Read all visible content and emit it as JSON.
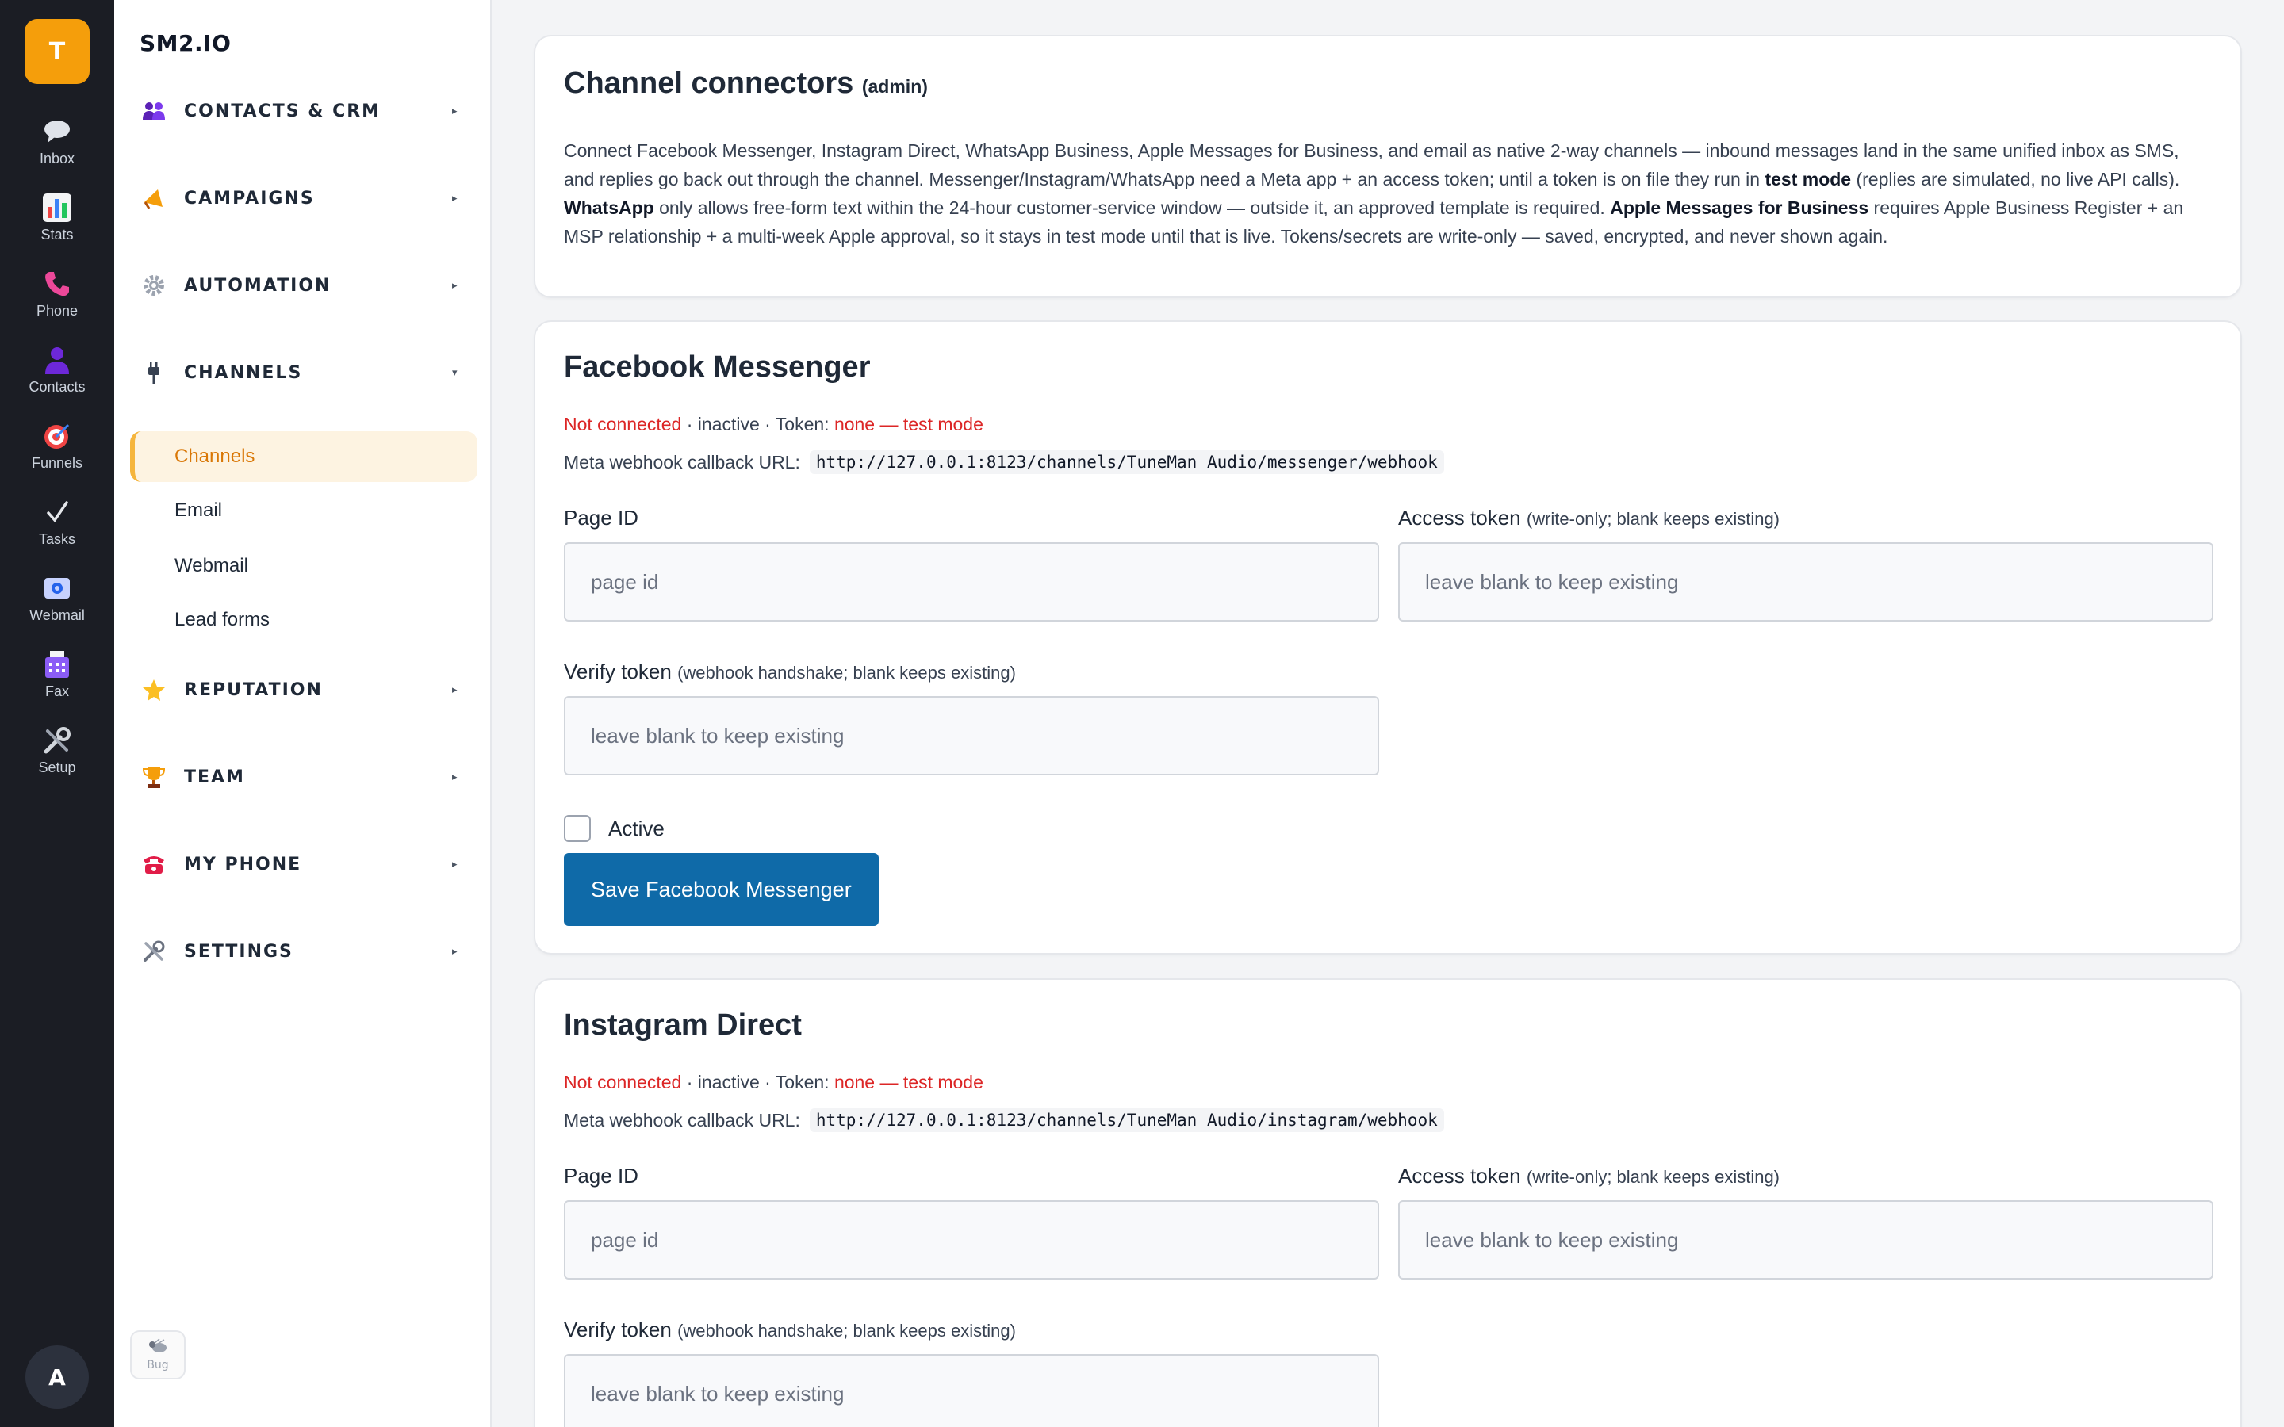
{
  "rail": {
    "brand_letter": "T",
    "items": [
      {
        "label": "Inbox",
        "icon": "speech-bubble-icon"
      },
      {
        "label": "Stats",
        "icon": "bar-chart-icon"
      },
      {
        "label": "Phone",
        "icon": "phone-icon"
      },
      {
        "label": "Contacts",
        "icon": "person-icon"
      },
      {
        "label": "Funnels",
        "icon": "target-icon"
      },
      {
        "label": "Tasks",
        "icon": "checkmark-icon"
      },
      {
        "label": "Webmail",
        "icon": "envelope-icon"
      },
      {
        "label": "Fax",
        "icon": "fax-icon"
      },
      {
        "label": "Setup",
        "icon": "tools-icon"
      }
    ],
    "avatar_letter": "A"
  },
  "sidebar": {
    "brand": "SM2.IO",
    "groups": [
      {
        "label": "CONTACTS & CRM",
        "caret": "▸",
        "icon": "people-icon"
      },
      {
        "label": "CAMPAIGNS",
        "caret": "▸",
        "icon": "megaphone-icon"
      },
      {
        "label": "AUTOMATION",
        "caret": "▸",
        "icon": "gear-icon"
      },
      {
        "label": "CHANNELS",
        "caret": "▾",
        "icon": "plug-icon"
      },
      {
        "label": "REPUTATION",
        "caret": "▸",
        "icon": "star-icon"
      },
      {
        "label": "TEAM",
        "caret": "▸",
        "icon": "trophy-icon"
      },
      {
        "label": "MY PHONE",
        "caret": "▸",
        "icon": "telephone-icon"
      },
      {
        "label": "SETTINGS",
        "caret": "▸",
        "icon": "tools-icon"
      }
    ],
    "channel_items": [
      "Channels",
      "Email",
      "Webmail",
      "Lead forms"
    ],
    "bug_label": "Bug"
  },
  "intro_card": {
    "title": "Channel connectors",
    "title_suffix": "(admin)",
    "p1": "Connect Facebook Messenger, Instagram Direct, WhatsApp Business, Apple Messages for Business, and email as native 2-way channels — inbound messages land in the same unified inbox as SMS, and replies go back out through the channel. Messenger/Instagram/WhatsApp need a Meta app + an access token; until a token is on file they run in ",
    "b1": "test mode",
    "p2": " (replies are simulated, no live API calls). ",
    "b2": "WhatsApp",
    "p3": " only allows free-form text within the 24-hour customer-service window — outside it, an approved template is required. ",
    "b3": "Apple Messages for Business",
    "p4": " requires Apple Business Register + an MSP relationship + a multi-week Apple approval, so it stays in test mode until that is live. Tokens/secrets are write-only — saved, encrypted, and never shown again."
  },
  "messenger": {
    "title": "Facebook Messenger",
    "status_conn": "Not connected",
    "status_mid": " · inactive · Token: ",
    "status_token": "none — test mode",
    "webhook_label": "Meta webhook callback URL:",
    "webhook_url": "http://127.0.0.1:8123/channels/TuneMan Audio/messenger/webhook",
    "page_id_label": "Page ID",
    "page_id_placeholder": "page id",
    "access_label": "Access token",
    "access_hint": "(write-only; blank keeps existing)",
    "access_placeholder": "leave blank to keep existing",
    "verify_label": "Verify token",
    "verify_hint": "(webhook handshake; blank keeps existing)",
    "verify_placeholder": "leave blank to keep existing",
    "active_label": "Active",
    "save_label": "Save Facebook Messenger"
  },
  "instagram": {
    "title": "Instagram Direct",
    "status_conn": "Not connected",
    "status_mid": " · inactive · Token: ",
    "status_token": "none — test mode",
    "webhook_label": "Meta webhook callback URL:",
    "webhook_url": "http://127.0.0.1:8123/channels/TuneMan Audio/instagram/webhook",
    "page_id_label": "Page ID",
    "page_id_placeholder": "page id",
    "access_label": "Access token",
    "access_hint": "(write-only; blank keeps existing)",
    "access_placeholder": "leave blank to keep existing",
    "verify_label": "Verify token",
    "verify_hint": "(webhook handshake; blank keeps existing)",
    "verify_placeholder": "leave blank to keep existing"
  },
  "colors": {
    "rail_bg": "#1b1d24",
    "brand_accent": "#f59e0b",
    "active_nav_bg": "#fdf3e1",
    "status_red": "#dc2626",
    "primary_button": "#0f6aa8"
  }
}
